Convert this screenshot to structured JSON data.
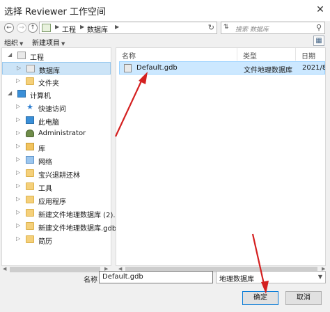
{
  "window": {
    "title": "选择 Reviewer 工作空间",
    "close_glyph": "✕"
  },
  "navigation": {
    "back_icon": "back-arrow-icon",
    "forward_icon": "forward-arrow-icon",
    "up_icon": "up-arrow-icon",
    "breadcrumb": [
      "工程",
      "数据库"
    ],
    "refresh_icon": "refresh-icon",
    "search_placeholder": "搜索 数据库"
  },
  "toolbar": {
    "organize_label": "组织",
    "new_item_label": "新建项目",
    "view_icon": "view-toggle-icon"
  },
  "tree": {
    "items": [
      {
        "label": "工程",
        "icon": "project-icon"
      },
      {
        "label": "数据库",
        "icon": "database-icon",
        "selected": true
      },
      {
        "label": "文件夹",
        "icon": "folder-icon"
      },
      {
        "label": "计算机",
        "icon": "computer-icon"
      },
      {
        "label": "快速访问",
        "icon": "star-icon"
      },
      {
        "label": "此电脑",
        "icon": "pc-icon"
      },
      {
        "label": "Administrator",
        "icon": "user-icon"
      },
      {
        "label": "库",
        "icon": "library-icon"
      },
      {
        "label": "网络",
        "icon": "network-icon"
      },
      {
        "label": "宝兴退耕还林",
        "icon": "folder-icon"
      },
      {
        "label": "工具",
        "icon": "folder-icon"
      },
      {
        "label": "应用程序",
        "icon": "folder-icon"
      },
      {
        "label": "新建文件地理数据库 (2).",
        "icon": "folder-icon"
      },
      {
        "label": "新建文件地理数据库.gdb",
        "icon": "folder-icon"
      },
      {
        "label": "简历",
        "icon": "folder-icon"
      }
    ]
  },
  "file_list": {
    "columns": [
      "名称",
      "类型",
      "日期"
    ],
    "rows": [
      {
        "name": "Default.gdb",
        "type": "文件地理数据库",
        "date": "2021/8/"
      }
    ]
  },
  "footer": {
    "name_label": "名称",
    "name_value": "Default.gdb",
    "type_value": "地理数据库",
    "ok_label": "确定",
    "cancel_label": "取消"
  },
  "colors": {
    "selection": "#cce8ff",
    "annotation_arrow": "#d42020"
  }
}
